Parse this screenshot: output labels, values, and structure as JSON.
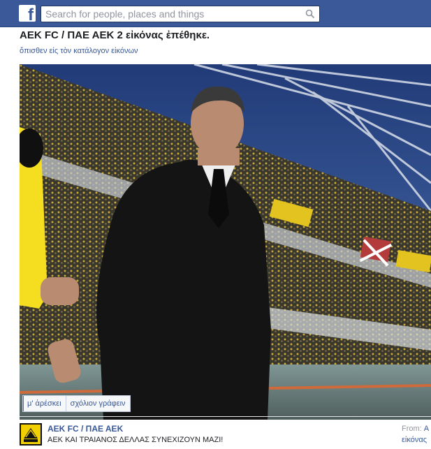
{
  "search": {
    "placeholder": "Search for people, places and things"
  },
  "post": {
    "headline": "ΑΕΚ FC / ΠΑΕ ΑΕΚ 2 εἰκόνας ἐπέθηκε.",
    "back_link": "ὄπισθεν εἰς τὸν κατάλογον εἰκόνων"
  },
  "actions": {
    "like": "μ' ἀρέσκει",
    "comment": "σχόλιον γράφειν"
  },
  "caption": {
    "author": "ΑΕΚ FC / ΠΑΕ ΑΕΚ",
    "text": "ΑΕΚ ΚΑΙ ΤΡΑΙΑΝΟΣ ΔΕΛΛΑΣ ΣΥΝΕΧΙΖΟΥΝ ΜΑΖΙ!"
  },
  "sidebar": {
    "from_label": "From:",
    "from_value": "Α",
    "count_text": "εἰκόνας"
  },
  "colors": {
    "brand": "#3b5998",
    "link": "#385898",
    "club_yellow": "#f2cf00"
  }
}
